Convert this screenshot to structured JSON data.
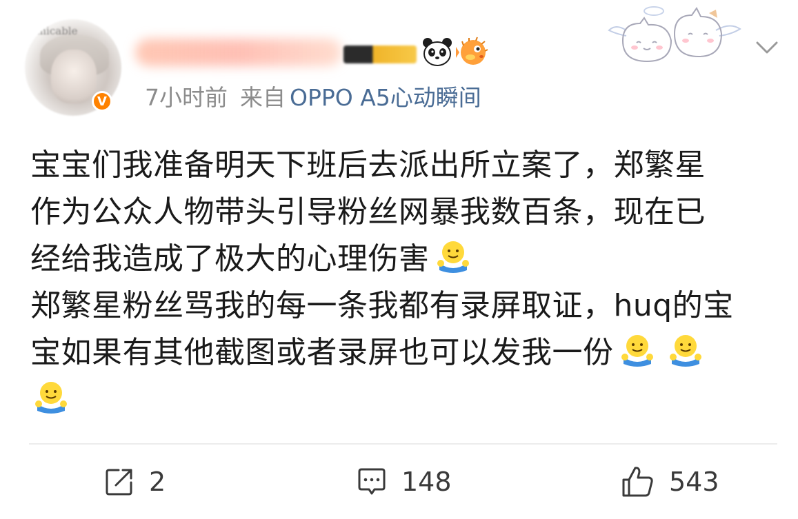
{
  "post": {
    "avatar_text": "Amicable",
    "time": "7小时前",
    "from_label": "来自",
    "device": "OPPO A5心动瞬间",
    "body_lines_1": [
      "宝宝们我准备明天下班后去派出所立案了，郑繁星",
      "作为公众人物带头引导粉丝网暴我数百条，现在已",
      "经给我造成了极大的心理伤害"
    ],
    "body_lines_2": [
      "郑繁星粉丝骂我的每一条我都有录屏取证，huq的宝",
      "宝如果有其他截图或者录屏也可以发我一份"
    ]
  },
  "actions": {
    "share_count": "2",
    "comment_count": "148",
    "like_count": "543"
  },
  "icons": {
    "verified": "verified-v-badge-icon",
    "emoji": "hug-emoji-icon",
    "share": "share-icon",
    "comment": "comment-icon",
    "like": "thumbs-up-icon",
    "menu": "chevron-down-icon"
  },
  "colors": {
    "link_blue": "#4a6c95",
    "meta_gray": "#8c8c8c",
    "verified_orange": "#ff8200"
  }
}
